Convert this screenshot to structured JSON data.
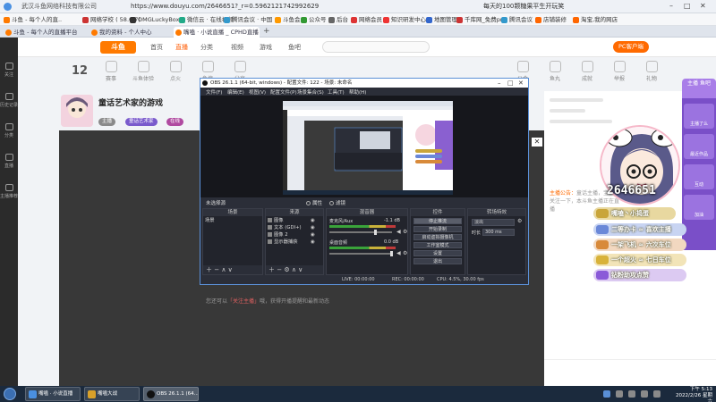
{
  "browser": {
    "url": "https://www.douyu.com/2646651?_r=0.5962121742992629",
    "url_prefix": "武汉斗鱼网络科技有限公司",
    "status_text": "每天的100颗糖果平生开玩笑",
    "search_hint": "搜索"
  },
  "bookmarks": [
    "斗鱼 - 每个人的直..",
    "网络学校 ( 58.0.7)",
    "OMGLuckyBox!",
    "微信云 · 在线视频",
    "腾讯会议 · 中国",
    "斗鱼会",
    "公众号",
    "后台",
    "网络会员",
    "知识研发中心",
    "地图管理",
    "千库网_免费png",
    "腾讯会议",
    "店铺装修",
    "淘宝,我的网店"
  ],
  "tabs": [
    {
      "label": "斗鱼 - 每个人的直播平台"
    },
    {
      "label": "我的资料 - 个人中心"
    },
    {
      "label": "嘴嗑 · 小说直播 _ CPHD直播"
    }
  ],
  "left_rail": [
    "关注",
    "历史记录",
    "分类",
    "直播",
    "主播推荐"
  ],
  "site": {
    "logo": "斗鱼",
    "nav": [
      "首页",
      "直播",
      "分类",
      "视频",
      "游戏",
      "鱼吧"
    ],
    "sub_stats": [
      "赛事",
      "斗鱼体验",
      "点火",
      "鱼塘",
      "分享",
      "公会",
      "鱼丸",
      "成就",
      "举报",
      "礼物"
    ],
    "big_number": "12",
    "pc_button": "PC客户端"
  },
  "streamer": {
    "title": "童话艺术家的游戏",
    "tags": [
      "主播",
      "童话艺术家",
      "在线"
    ]
  },
  "below_player": {
    "prefix": "您还可以",
    "link": "「关注主播」",
    "suffix": "哦，获得开播提醒和最新动态"
  },
  "right_panel": {
    "notice_label": "主播公告：",
    "notice_text": "童话主播，宝宝们关注一下，本斗鱼主播正在直播"
  },
  "obs": {
    "title": "OBS 26.1.1 (64-bit, windows) - 配置文件: 122 - 场景: 未命名",
    "menu": [
      "文件(F)",
      "编辑(E)",
      "视图(V)",
      "配置文件(P)",
      "场景集合(S)",
      "工具(T)",
      "帮助(H)"
    ],
    "source_bar_label": "未选择源",
    "source_bar_buttons": [
      "属性",
      "滤镜"
    ],
    "docks": {
      "scenes": {
        "header": "场景",
        "items": [
          "场景"
        ]
      },
      "sources": {
        "header": "来源",
        "items": [
          "图像",
          "文本 (GDI+)",
          "图像 2",
          "显示器捕获"
        ]
      },
      "mixer": {
        "header": "混音器",
        "channels": [
          {
            "name": "麦克风/Aux",
            "db": "-1.1 dB"
          },
          {
            "name": "桌面音频",
            "db": "0.0 dB"
          }
        ]
      },
      "transitions": {
        "header": "转场特效",
        "type": "淡出",
        "duration_label": "时长",
        "duration": "300 ms"
      },
      "controls": {
        "header": "控件",
        "buttons": [
          "停止推流",
          "开始录制",
          "启动虚拟摄像机",
          "工作室模式",
          "设置",
          "退出"
        ]
      }
    },
    "status": {
      "live": "LIVE: 00:00:00",
      "rec": "REC: 00:00:00",
      "cpu": "CPU: 4.5%, 30.00 fps"
    }
  },
  "overlay": {
    "streamer_id": "2646651",
    "rows": [
      {
        "text": "嘴嗑丶小捣蛋",
        "color": "#c9a53a"
      },
      {
        "text": "二等办卡 ≈ 喜欢主播",
        "color": "#6a88d8"
      },
      {
        "text": "一架飞机 ≈ 六次车位",
        "color": "#d88a3a"
      },
      {
        "text": "一个超火 ≈ 七日车位",
        "color": "#d8b23a"
      },
      {
        "text": "钻粉助攻点赞",
        "color": "#8a5ad8"
      }
    ]
  },
  "right_strip": {
    "header": "主播 鱼吧",
    "items": [
      "主播了么",
      "最近作品",
      "互动",
      "加油"
    ]
  },
  "taskbar": {
    "apps": [
      "嘴嗑 · 小说直播",
      "嘴嗑大战",
      "OBS 26.1.1 (64..."
    ],
    "time": "下午 5:13",
    "date": "2022/2/26 星期六"
  }
}
